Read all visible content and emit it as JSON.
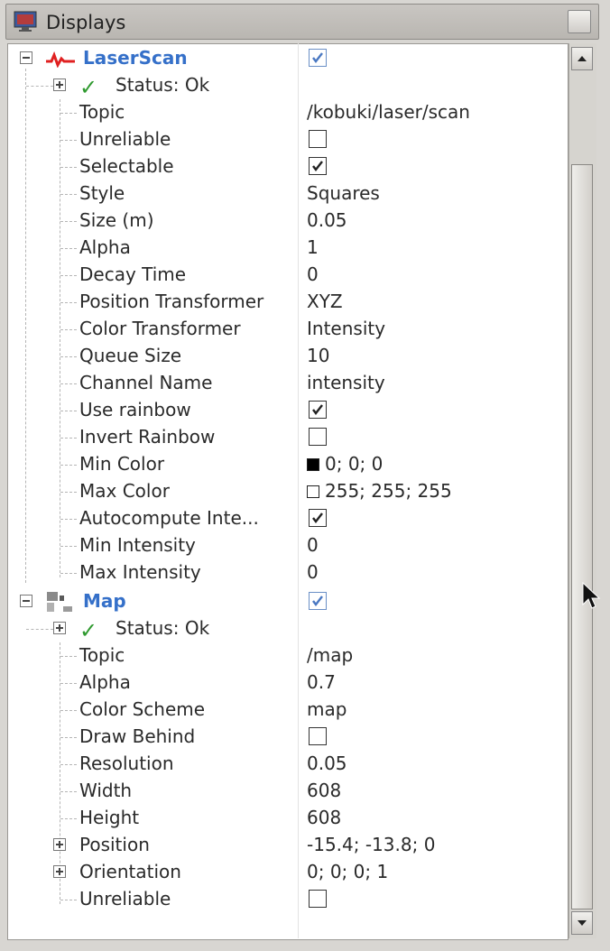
{
  "window": {
    "title": "Displays"
  },
  "laserscan": {
    "name": "LaserScan",
    "status": "Status: Ok",
    "rows": [
      {
        "label": "Topic",
        "value": "/kobuki/laser/scan"
      },
      {
        "label": "Unreliable",
        "value": ""
      },
      {
        "label": "Selectable",
        "value": ""
      },
      {
        "label": "Style",
        "value": "Squares"
      },
      {
        "label": "Size (m)",
        "value": "0.05"
      },
      {
        "label": "Alpha",
        "value": "1"
      },
      {
        "label": "Decay Time",
        "value": "0"
      },
      {
        "label": "Position Transformer",
        "value": "XYZ"
      },
      {
        "label": "Color Transformer",
        "value": "Intensity"
      },
      {
        "label": "Queue Size",
        "value": "10"
      },
      {
        "label": "Channel Name",
        "value": "intensity"
      },
      {
        "label": "Use rainbow",
        "value": ""
      },
      {
        "label": "Invert Rainbow",
        "value": ""
      },
      {
        "label": "Min Color",
        "value": "0; 0; 0"
      },
      {
        "label": "Max Color",
        "value": "255; 255; 255"
      },
      {
        "label": "Autocompute Inte...",
        "value": ""
      },
      {
        "label": "Min Intensity",
        "value": "0"
      },
      {
        "label": "Max Intensity",
        "value": "0"
      }
    ]
  },
  "map": {
    "name": "Map",
    "status": "Status: Ok",
    "rows": [
      {
        "label": "Topic",
        "value": "/map"
      },
      {
        "label": "Alpha",
        "value": "0.7"
      },
      {
        "label": "Color Scheme",
        "value": "map"
      },
      {
        "label": "Draw Behind",
        "value": ""
      },
      {
        "label": "Resolution",
        "value": "0.05"
      },
      {
        "label": "Width",
        "value": "608"
      },
      {
        "label": "Height",
        "value": "608"
      },
      {
        "label": "Position",
        "value": "-15.4; -13.8; 0"
      },
      {
        "label": "Orientation",
        "value": "0; 0; 0; 1"
      },
      {
        "label": "Unreliable",
        "value": ""
      }
    ]
  },
  "checkboxes": {
    "laserscan_enabled": true,
    "unreliable": false,
    "selectable": true,
    "use_rainbow": true,
    "invert_rainbow": false,
    "autocompute": true,
    "map_enabled": true,
    "draw_behind": false,
    "map_unreliable": false
  },
  "colors": {
    "min_color_swatch": "#000000",
    "max_color_swatch": "#ffffff",
    "header_text": "#3570c9",
    "status_check": "#2f9a2f",
    "laserscan_icon": "#e02020"
  },
  "icons": {
    "window": "monitor-icon",
    "laserscan": "laserscan-wave-icon",
    "map": "map-grid-icon",
    "status": "checkmark-icon",
    "expand": "plus-box-icon",
    "collapse": "minus-box-icon"
  }
}
